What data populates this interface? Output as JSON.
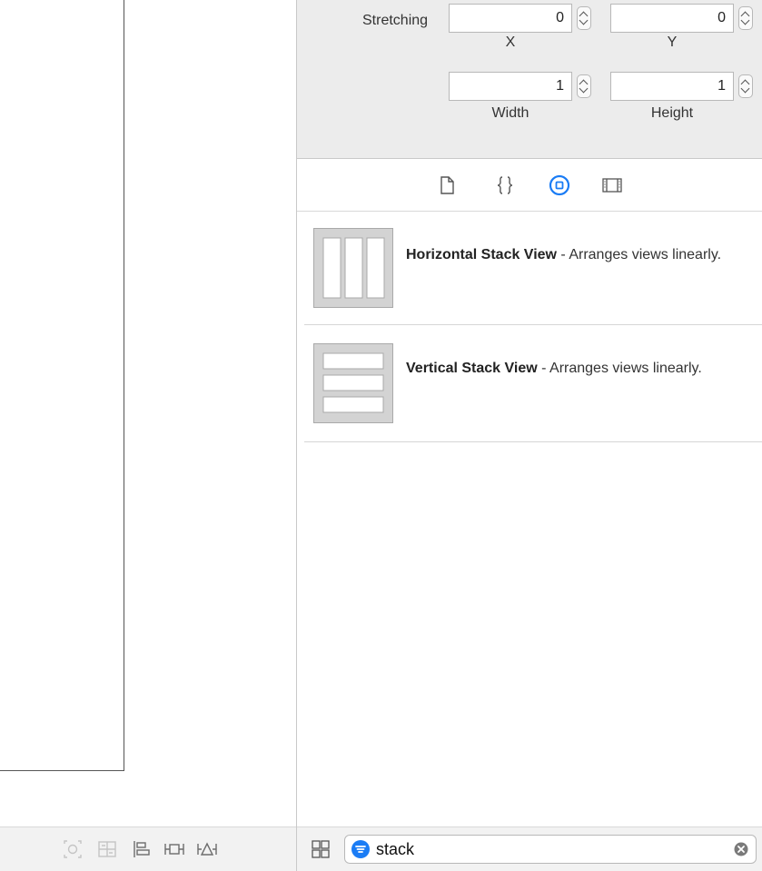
{
  "inspector": {
    "stretching_label": "Stretching",
    "x": {
      "value": "0",
      "label": "X"
    },
    "y": {
      "value": "0",
      "label": "Y"
    },
    "width": {
      "value": "1",
      "label": "Width"
    },
    "height": {
      "value": "1",
      "label": "Height"
    }
  },
  "library": {
    "tabs": [
      {
        "icon": "file-icon"
      },
      {
        "icon": "braces-icon"
      },
      {
        "icon": "object-icon",
        "selected": true
      },
      {
        "icon": "media-icon"
      }
    ],
    "items": [
      {
        "name": "Horizontal Stack View",
        "sep": " - ",
        "desc": "Arranges views linearly."
      },
      {
        "name": "Vertical Stack View",
        "sep": " - ",
        "desc": "Arranges views linearly."
      }
    ]
  },
  "filter": {
    "value": "stack"
  },
  "colors": {
    "accent": "#1a7cf5",
    "panel_bg": "#ececec"
  }
}
